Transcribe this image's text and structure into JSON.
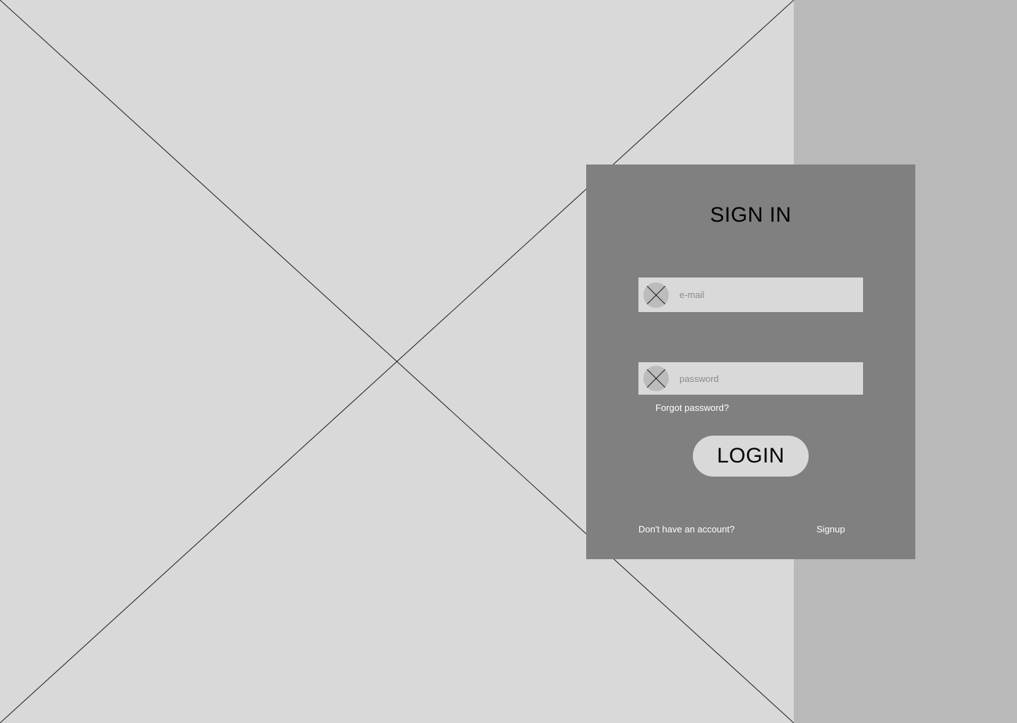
{
  "hero": {
    "image_icon": "image-placeholder-cross"
  },
  "signin": {
    "title": "SIGN IN",
    "email": {
      "icon": "placeholder-avatar-icon",
      "placeholder": "e-mail",
      "value": ""
    },
    "password": {
      "icon": "placeholder-avatar-icon",
      "placeholder": "password",
      "value": ""
    },
    "forgot_label": "Forgot password?",
    "login_label": "LOGIN",
    "no_account_label": "Don't have an account?",
    "signup_label": "Signup"
  },
  "colors": {
    "background": "#d9d9d9",
    "side_panel": "#b9b9b9",
    "card": "#808080",
    "field": "#d9d9d9",
    "link_text": "#ffffff"
  }
}
